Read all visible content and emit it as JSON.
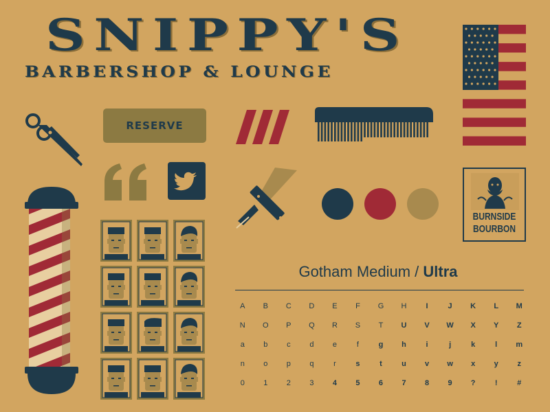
{
  "logo": {
    "title": "SNIPPY'S",
    "subtitle": "BARBERSHOP & LOUNGE"
  },
  "reserve_button": {
    "label": "RESERVE"
  },
  "badge": {
    "line1": "BURNSIDE",
    "line2": "BOURBON"
  },
  "typography": {
    "title_regular": "Gotham Medium /",
    "title_bold": "Ultra",
    "rows": [
      [
        {
          "c": "A",
          "b": false
        },
        {
          "c": "B",
          "b": false
        },
        {
          "c": "C",
          "b": false
        },
        {
          "c": "D",
          "b": false
        },
        {
          "c": "E",
          "b": false
        },
        {
          "c": "F",
          "b": false
        },
        {
          "c": "G",
          "b": false
        },
        {
          "c": "H",
          "b": false
        },
        {
          "c": "I",
          "b": true
        },
        {
          "c": "J",
          "b": true
        },
        {
          "c": "K",
          "b": true
        },
        {
          "c": "L",
          "b": true
        },
        {
          "c": "M",
          "b": true
        }
      ],
      [
        {
          "c": "N",
          "b": false
        },
        {
          "c": "O",
          "b": false
        },
        {
          "c": "P",
          "b": false
        },
        {
          "c": "Q",
          "b": false
        },
        {
          "c": "R",
          "b": false
        },
        {
          "c": "S",
          "b": false
        },
        {
          "c": "T",
          "b": false
        },
        {
          "c": "U",
          "b": true
        },
        {
          "c": "V",
          "b": true
        },
        {
          "c": "W",
          "b": true
        },
        {
          "c": "X",
          "b": true
        },
        {
          "c": "Y",
          "b": true
        },
        {
          "c": "Z",
          "b": true
        }
      ],
      [
        {
          "c": "a",
          "b": false
        },
        {
          "c": "b",
          "b": false
        },
        {
          "c": "c",
          "b": false
        },
        {
          "c": "d",
          "b": false
        },
        {
          "c": "e",
          "b": false
        },
        {
          "c": "f",
          "b": false
        },
        {
          "c": "g",
          "b": true
        },
        {
          "c": "h",
          "b": true
        },
        {
          "c": "i",
          "b": true
        },
        {
          "c": "j",
          "b": true
        },
        {
          "c": "k",
          "b": true
        },
        {
          "c": "l",
          "b": true
        },
        {
          "c": "m",
          "b": true
        }
      ],
      [
        {
          "c": "n",
          "b": false
        },
        {
          "c": "o",
          "b": false
        },
        {
          "c": "p",
          "b": false
        },
        {
          "c": "q",
          "b": false
        },
        {
          "c": "r",
          "b": false
        },
        {
          "c": "s",
          "b": true
        },
        {
          "c": "t",
          "b": true
        },
        {
          "c": "u",
          "b": true
        },
        {
          "c": "v",
          "b": true
        },
        {
          "c": "w",
          "b": true
        },
        {
          "c": "x",
          "b": true
        },
        {
          "c": "y",
          "b": true
        },
        {
          "c": "z",
          "b": true
        }
      ],
      [
        {
          "c": "0",
          "b": false
        },
        {
          "c": "1",
          "b": false
        },
        {
          "c": "2",
          "b": false
        },
        {
          "c": "3",
          "b": false
        },
        {
          "c": "4",
          "b": true
        },
        {
          "c": "5",
          "b": true
        },
        {
          "c": "6",
          "b": true
        },
        {
          "c": "7",
          "b": true
        },
        {
          "c": "8",
          "b": true
        },
        {
          "c": "9",
          "b": true
        },
        {
          "c": "?",
          "b": true
        },
        {
          "c": "!",
          "b": true
        },
        {
          "c": "#",
          "b": true
        }
      ]
    ]
  },
  "palette": {
    "navy": "#1f3a4a",
    "red": "#a02a36",
    "gold": "#a88a4e",
    "background": "#d2a560",
    "cream": "#e8cfa0"
  },
  "icons": [
    "scissors-icon",
    "stripes-icon",
    "comb-icon",
    "us-flag-icon",
    "quote-icon",
    "twitter-icon",
    "razor-icon",
    "barber-pole-icon",
    "portrait-icon"
  ],
  "portraits": [
    {
      "hair": "flat"
    },
    {
      "hair": "flat"
    },
    {
      "hair": "side"
    },
    {
      "hair": "flat"
    },
    {
      "hair": "flat"
    },
    {
      "hair": "side"
    },
    {
      "hair": "flat"
    },
    {
      "hair": "quiff"
    },
    {
      "hair": "side"
    },
    {
      "hair": "flat"
    },
    {
      "hair": "flat"
    },
    {
      "hair": "side"
    }
  ]
}
